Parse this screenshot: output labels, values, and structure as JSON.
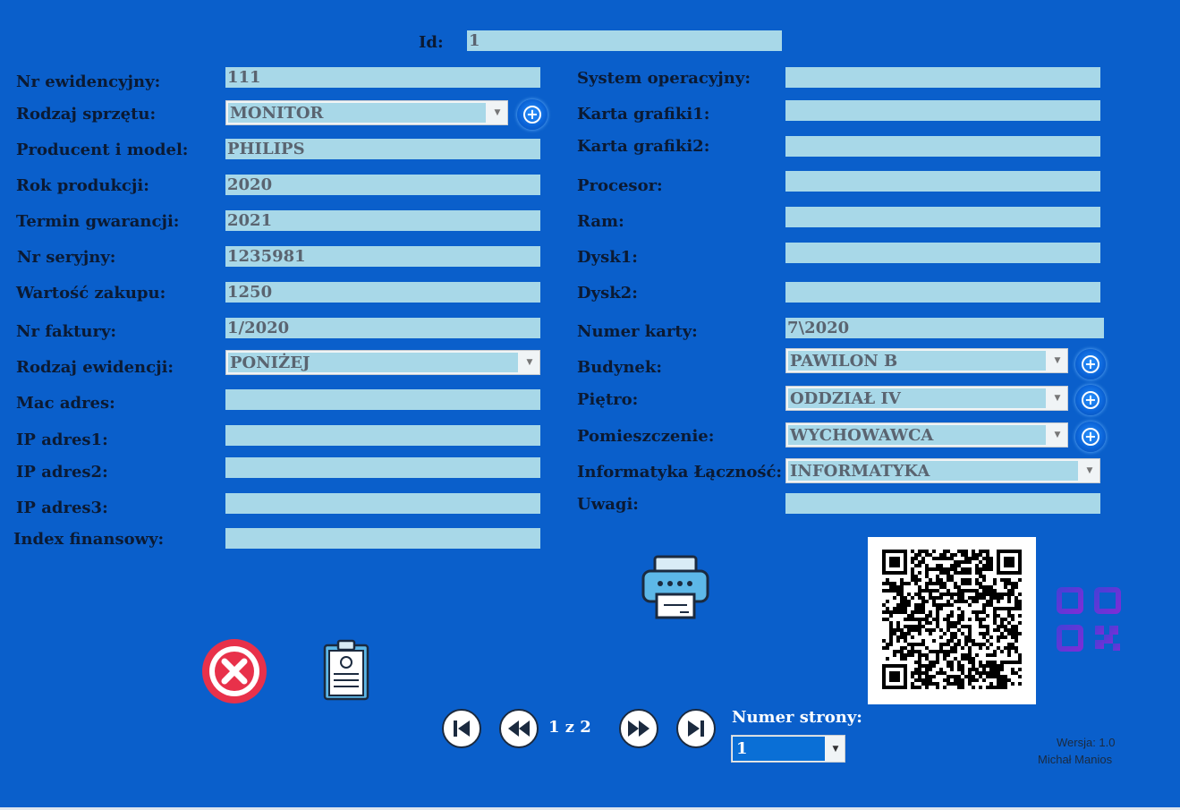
{
  "header": {
    "id_label": "Id:",
    "id_value": "1"
  },
  "left_fields": [
    {
      "label": "Nr ewidencyjny:",
      "value": "111"
    },
    {
      "label": "Rodzaj sprzętu:",
      "value": "MONITOR"
    },
    {
      "label": "Producent i model:",
      "value": "PHILIPS"
    },
    {
      "label": "Rok produkcji:",
      "value": "2020"
    },
    {
      "label": "Termin gwarancji:",
      "value": "2021"
    },
    {
      "label": "Nr seryjny:",
      "value": "1235981"
    },
    {
      "label": "Wartość zakupu:",
      "value": "1250"
    },
    {
      "label": "Nr faktury:",
      "value": "1/2020"
    },
    {
      "label": "Rodzaj ewidencji:",
      "value": "PONIŻEJ"
    },
    {
      "label": "Mac adres:",
      "value": ""
    },
    {
      "label": "IP adres1:",
      "value": ""
    },
    {
      "label": "IP adres2:",
      "value": ""
    },
    {
      "label": "IP adres3:",
      "value": ""
    },
    {
      "label": "Index finansowy:",
      "value": ""
    }
  ],
  "right_fields": [
    {
      "label": "System operacyjny:",
      "value": ""
    },
    {
      "label": "Karta grafiki1:",
      "value": ""
    },
    {
      "label": "Karta grafiki2:",
      "value": ""
    },
    {
      "label": "Procesor:",
      "value": ""
    },
    {
      "label": "Ram:",
      "value": ""
    },
    {
      "label": "Dysk1:",
      "value": ""
    },
    {
      "label": "Dysk2:",
      "value": ""
    },
    {
      "label": "Numer karty:",
      "value": "7\\2020"
    },
    {
      "label": "Budynek:",
      "value": "PAWILON B"
    },
    {
      "label": "Piętro:",
      "value": "ODDZIAŁ IV"
    },
    {
      "label": "Pomieszczenie:",
      "value": "WYCHOWAWCA"
    },
    {
      "label": "Informatyka Łączność:",
      "value": "INFORMATYKA"
    },
    {
      "label": "Uwagi:",
      "value": ""
    }
  ],
  "pagination": {
    "page_info": "1 z 2",
    "page_number_label": "Numer strony:",
    "page_number_value": "1"
  },
  "footer": {
    "version": "Wersja: 1.0",
    "author": "Michał Manios"
  },
  "icons": {
    "add": "add-circle-icon",
    "delete": "delete-icon",
    "report": "clipboard-icon",
    "print": "printer-icon",
    "qr": "qr-code-icon",
    "first": "first-page-icon",
    "prev": "previous-page-icon",
    "next": "next-page-icon",
    "last": "last-page-icon"
  },
  "colors": {
    "background": "#0a5fcb",
    "field": "#a8d8e8",
    "label": "#0b1a33"
  }
}
